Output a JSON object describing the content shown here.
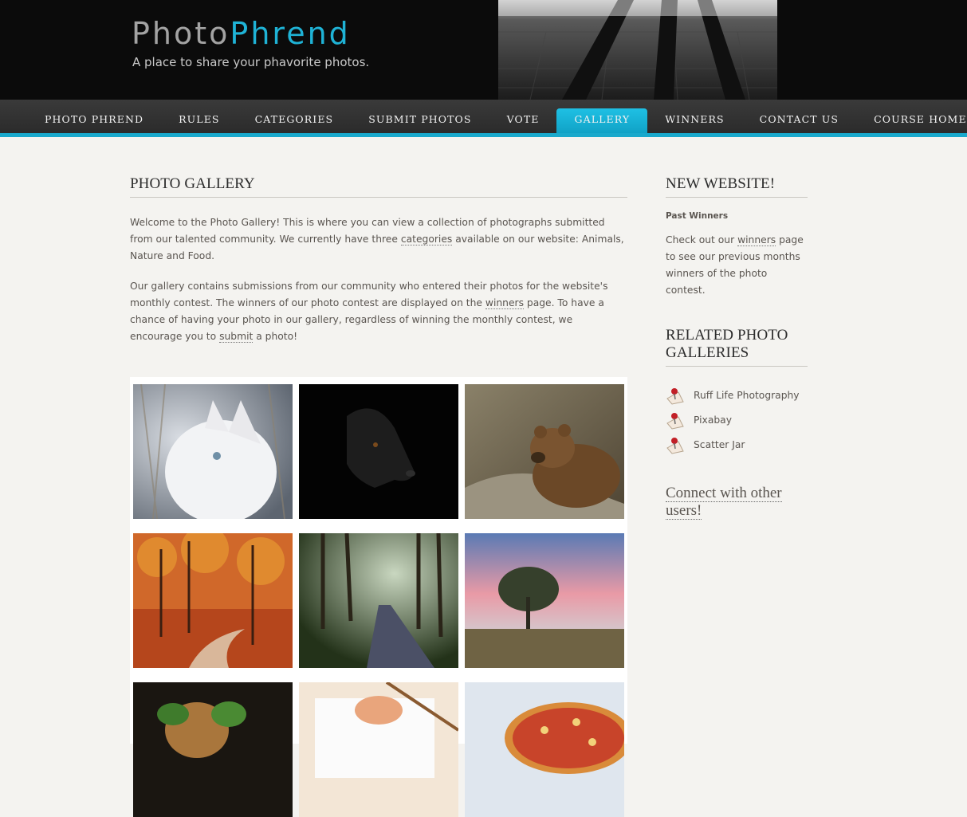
{
  "site": {
    "logo_part1": "Photo",
    "logo_part2": "Phrend",
    "tagline": "A place to share your phavorite photos."
  },
  "nav": {
    "items": [
      {
        "label": "Photo Phrend",
        "active": false
      },
      {
        "label": "Rules",
        "active": false
      },
      {
        "label": "Categories",
        "active": false
      },
      {
        "label": "Submit Photos",
        "active": false
      },
      {
        "label": "Vote",
        "active": false
      },
      {
        "label": "Gallery",
        "active": true
      },
      {
        "label": "Winners",
        "active": false
      },
      {
        "label": "Contact Us",
        "active": false
      },
      {
        "label": "Course Homepage",
        "active": false
      }
    ]
  },
  "main": {
    "title": "PHOTO GALLERY",
    "intro1": {
      "pre": "Welcome to the Photo Gallery! This is where you can view a collection of photographs submitted from our talented community. We currently have three ",
      "link": "categories",
      "post": " available on our website: Animals, Nature and Food."
    },
    "intro2": {
      "pre": "Our gallery contains submissions from our community who entered their photos for the website's monthly contest. The winners of our photo contest are displayed on the ",
      "link1": "winners",
      "mid": " page. To have a chance of having your photo in our gallery, regardless of winning the monthly contest, we encourage you to ",
      "link2": "submit",
      "post": " a photo!"
    },
    "gallery": [
      {
        "subject": "white cat"
      },
      {
        "subject": "black dog"
      },
      {
        "subject": "brown bear"
      },
      {
        "subject": "autumn forest path"
      },
      {
        "subject": "forest road"
      },
      {
        "subject": "tree at sunset"
      },
      {
        "subject": "basil food"
      },
      {
        "subject": "sushi plate"
      },
      {
        "subject": "pizza"
      }
    ]
  },
  "sidebar": {
    "new_title": "NEW WEBSITE!",
    "past_winners": "Past Winners",
    "winners_pre": "Check out our ",
    "winners_link": "winners",
    "winners_post": " page to see our previous months winners of the photo contest.",
    "related_title": "RELATED PHOTO GALLERIES",
    "related": [
      {
        "label": "Ruff Life Photography"
      },
      {
        "label": "Pixabay"
      },
      {
        "label": "Scatter Jar"
      }
    ],
    "connect": "Connect with other users!"
  },
  "colors": {
    "accent": "#19a9cc",
    "background": "#f4f3f0",
    "header": "#0b0b0b"
  }
}
